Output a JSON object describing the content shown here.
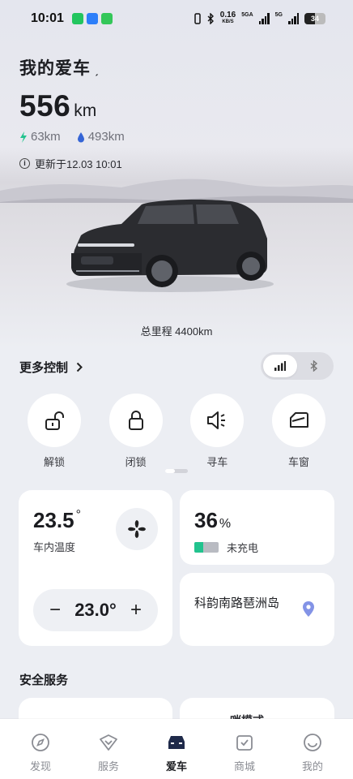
{
  "status_bar": {
    "time": "10:01",
    "network_speed_value": "0.16",
    "network_speed_unit": "KB/S",
    "signal_1_label": "5GA",
    "signal_2_label": "5G",
    "battery_level": "34",
    "app_icons": [
      "wechat-icon",
      "alipay-icon",
      "messages-icon"
    ],
    "app_icon_colors": [
      "#22c55e",
      "#2d7ff9",
      "#34c759"
    ]
  },
  "hero": {
    "title": "我的爱车",
    "range_value": "556",
    "range_unit": "km",
    "electric_range": "63km",
    "fuel_range": "493km",
    "updated_text": "更新于12.03 10:01",
    "odometer": "总里程 4400km"
  },
  "controls": {
    "more_label": "更多控制",
    "connection_modes": [
      "cellular-signal-icon",
      "bluetooth-icon"
    ],
    "active_mode": "cellular",
    "items": [
      {
        "icon": "unlock-icon",
        "label": "解锁"
      },
      {
        "icon": "lock-icon",
        "label": "闭锁"
      },
      {
        "icon": "horn-icon",
        "label": "寻车"
      },
      {
        "icon": "window-icon",
        "label": "车窗"
      }
    ]
  },
  "climate": {
    "interior_temp": "23.5",
    "degree": "°",
    "interior_label": "车内温度",
    "set_temp": "23.0°",
    "minus": "−",
    "plus": "+"
  },
  "battery": {
    "percent": "36",
    "percent_sign": "%",
    "level": 0.36,
    "status": "未充电",
    "accent_color": "#22c38e"
  },
  "location": {
    "address": "科韵南路琶洲岛"
  },
  "safety": {
    "section_title": "安全服务",
    "card2_peek": "哨模式"
  },
  "tabbar": {
    "active": "爱车",
    "tabs": [
      {
        "icon": "compass-icon",
        "label": "发现"
      },
      {
        "icon": "service-heart-icon",
        "label": "服务"
      },
      {
        "icon": "car-icon",
        "label": "爱车"
      },
      {
        "icon": "shop-bag-icon",
        "label": "商城"
      },
      {
        "icon": "profile-icon",
        "label": "我的"
      }
    ]
  }
}
